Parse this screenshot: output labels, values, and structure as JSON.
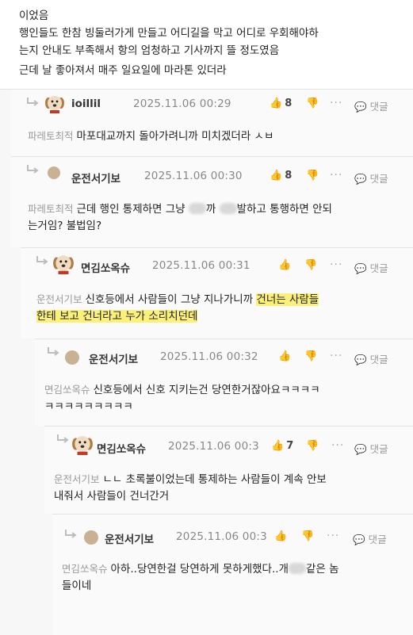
{
  "post_body": {
    "lines": [
      "이었음",
      "행인들도 한참 빙둘러가게 만들고 어디길을 막고 어디로 우회해야하",
      "는지 안내도 부족해서 항의 엄청하고 기사까지 뜰 정도였음",
      "근데 날 좋아져서 매주 일요일에 마라톤 있더라"
    ]
  },
  "ui": {
    "reply_label": "댓글",
    "more_label": "···"
  },
  "comments": [
    {
      "nickname": "ioillil",
      "date": "2025.11.06 00:29",
      "likes": "8",
      "mention": "파레토최적",
      "text": "마포대교까지 돌아가려니까 미치겠더라 ㅅㅂ"
    },
    {
      "nickname": "운전서기보",
      "date": "2025.11.06 00:30",
      "likes": "8",
      "mention": "파레토최적",
      "text_a": "근데 행인 통제하면 그냥",
      "text_b": "까",
      "text_c": "발하고 통행하면 안되",
      "text_2": "는거임? 불법임?"
    },
    {
      "nickname": "면김쏘옥슈",
      "date": "2025.11.06 00:31",
      "mention": "운전서기보",
      "text_a": "신호등에서 사람들이 그냥 지나가니까",
      "text_hl1": "건너는 사람들",
      "text_hl2": "한테 보고 건너라고 누가 소리치던데"
    },
    {
      "nickname": "운전서기보",
      "date": "2025.11.06 00:32",
      "mention": "면김쏘옥슈",
      "text_1": "신호등에서 신호 지키는건 당연한거잖아요ㅋㅋㅋㅋ",
      "text_2": "ㅋㅋㅋㅋㅋㅋㅋㅋㅋ"
    },
    {
      "nickname": "면김쏘옥슈",
      "date": "2025.11.06 00:3",
      "likes": "7",
      "mention": "운전서기보",
      "text_1": "ㄴㄴ 초록불이었는데 통제하는 사람들이 계속 안보",
      "text_2": "내줘서 사람들이 건너간거"
    },
    {
      "nickname": "운전서기보",
      "date": "2025.11.06 00:3",
      "mention": "면김쏘옥슈",
      "text_a": "아하..당연한걸 당연하게 못하게했다..개",
      "text_b": "같은 놈",
      "text_2": "들이네"
    }
  ]
}
